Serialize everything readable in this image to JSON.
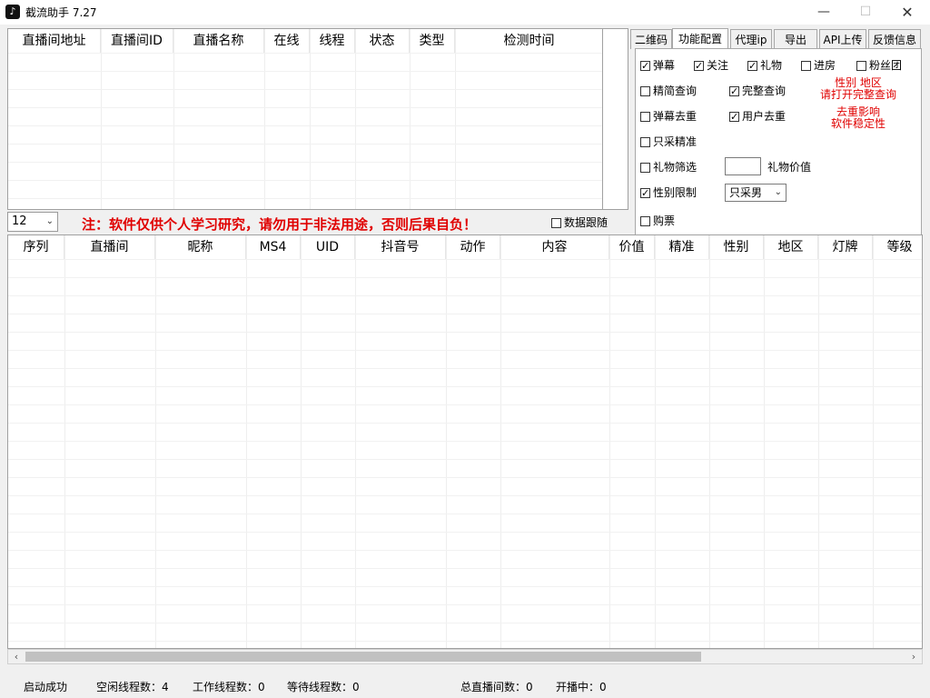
{
  "window": {
    "title": "截流助手 7.27",
    "icon": "tiktok-icon",
    "minimize_label": "—",
    "maximize_label": "☐",
    "close_label": "✕"
  },
  "room_table": {
    "columns": [
      "直播间地址",
      "直播间ID",
      "直播名称",
      "在线",
      "线程",
      "状态",
      "类型",
      "检测时间"
    ]
  },
  "tabs": [
    {
      "label": "二维码",
      "active": false
    },
    {
      "label": "功能配置",
      "active": true
    },
    {
      "label": "代理ip",
      "active": false
    },
    {
      "label": "导出",
      "active": false
    },
    {
      "label": "API上传",
      "active": false
    },
    {
      "label": "反馈信息",
      "active": false
    }
  ],
  "config": {
    "danmu": {
      "label": "弹幕",
      "checked": true
    },
    "follow": {
      "label": "关注",
      "checked": true
    },
    "gift": {
      "label": "礼物",
      "checked": true
    },
    "enter_room": {
      "label": "进房",
      "checked": false
    },
    "fans_club": {
      "label": "粉丝团",
      "checked": false
    },
    "simple_query": {
      "label": "精简查询",
      "checked": false
    },
    "full_query": {
      "label": "完整查询",
      "checked": true
    },
    "danmu_dedup": {
      "label": "弹幕去重",
      "checked": false
    },
    "user_dedup": {
      "label": "用户去重",
      "checked": true
    },
    "only_precise": {
      "label": "只采精准",
      "checked": false
    },
    "gift_filter": {
      "label": "礼物筛选",
      "checked": false
    },
    "gift_value_label": "礼物价值",
    "gift_value": "",
    "gender_limit": {
      "label": "性别限制",
      "checked": true
    },
    "gender_select": "只采男",
    "ticket": {
      "label": "购票",
      "checked": false
    },
    "note1_line1": "性别 地区",
    "note1_line2": "请打开完整查询",
    "note2_line1": "去重影响",
    "note2_line2": "软件稳定性"
  },
  "middle": {
    "page_size": "12",
    "notice": "注：软件仅供个人学习研究，请勿用于非法用途，否则后果自负！",
    "data_follow": {
      "label": "数据跟随",
      "checked": false
    }
  },
  "msg_table": {
    "columns": [
      "序列",
      "直播间",
      "昵称",
      "MS4",
      "UID",
      "抖音号",
      "动作",
      "内容",
      "价值",
      "精准",
      "性别",
      "地区",
      "灯牌",
      "等级"
    ]
  },
  "status": {
    "started": "启动成功",
    "idle_threads": "空闲线程数：4",
    "working_threads": "工作线程数：0",
    "waiting_threads": "等待线程数：0",
    "total_rooms": "总直播间数：0",
    "live_now": "开播中：0"
  }
}
